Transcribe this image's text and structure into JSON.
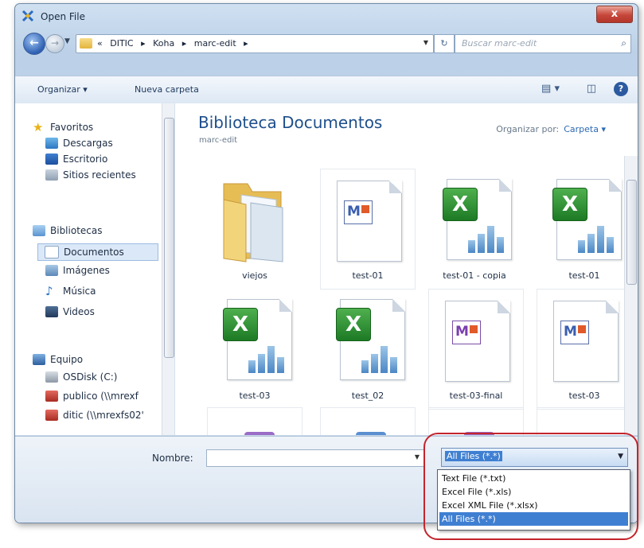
{
  "window": {
    "title": "Open File",
    "close_label": "x"
  },
  "address_bar": {
    "crumbs": [
      "«",
      "DITIC",
      "▸",
      "Koha",
      "▸",
      "marc-edit",
      "▸"
    ],
    "search_placeholder": "Buscar marc-edit"
  },
  "toolbar": {
    "organize_label": "Organizar ▾",
    "new_folder_label": "Nueva carpeta"
  },
  "sidebar": {
    "favorites_label": "Favoritos",
    "favorites": [
      "Descargas",
      "Escritorio",
      "Sitios recientes"
    ],
    "libraries_label": "Bibliotecas",
    "libraries": [
      "Documentos",
      "Imágenes",
      "Música",
      "Videos"
    ],
    "computer_label": "Equipo",
    "computer": [
      "OSDisk (C:)",
      "publico (\\\\mrexf",
      "ditic (\\\\mrexfs02'"
    ]
  },
  "content": {
    "library_title": "Biblioteca Documentos",
    "library_subtitle": "marc-edit",
    "arrange_by_label": "Organizar por:",
    "arrange_by_value": "Carpeta ▾",
    "files": [
      {
        "name": "viejos",
        "type": "folder"
      },
      {
        "name": "test-01",
        "type": "marc"
      },
      {
        "name": "test-01 - copia",
        "type": "excel"
      },
      {
        "name": "test-01",
        "type": "excel"
      },
      {
        "name": "test-03",
        "type": "excel"
      },
      {
        "name": "test_02",
        "type": "excel"
      },
      {
        "name": "test-03-final",
        "type": "marc"
      },
      {
        "name": "test-03",
        "type": "marc"
      }
    ]
  },
  "bottom": {
    "name_label": "Nombre:",
    "name_value": "",
    "filter_selected": "All Files (*.*)",
    "filter_options": [
      "Text File (*.txt)",
      "Excel File (*.xls)",
      "Excel XML File (*.xlsx)",
      "All Files (*.*)"
    ]
  },
  "colors": {
    "accent": "#3f7fd2",
    "highlight_ring": "#c4242c",
    "excel_green": "#1d7a25",
    "title_blue": "#1e4f8c"
  }
}
